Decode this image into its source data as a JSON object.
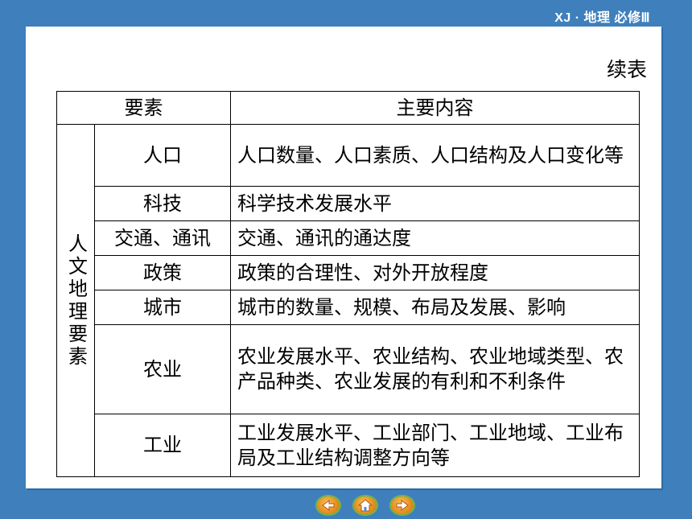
{
  "header": {
    "text": "XJ · 地理  必修Ⅲ"
  },
  "slide": {
    "subtitle": "续表",
    "table": {
      "col_factor": "要素",
      "col_content": "主要内容",
      "group_label": "人文地理要素",
      "rows": [
        {
          "factor": "人口",
          "content": "人口数量、人口素质、人口结构及人口变化等"
        },
        {
          "factor": "科技",
          "content": "科学技术发展水平"
        },
        {
          "factor": "交通、通讯",
          "content": "交通、通讯的通达度"
        },
        {
          "factor": "政策",
          "content": "政策的合理性、对外开放程度"
        },
        {
          "factor": "城市",
          "content": "城市的数量、规模、布局及发展、影响"
        },
        {
          "factor": "农业",
          "content": "农业发展水平、农业结构、农业地域类型、农产品种类、农业发展的有利和不利条件"
        },
        {
          "factor": "工业",
          "content": "工业发展水平、工业部门、工业地域、工业布局及工业结构调整方向等"
        }
      ]
    }
  },
  "nav": {
    "buttons": [
      {
        "icon": "back-icon"
      },
      {
        "icon": "home-icon"
      },
      {
        "icon": "forward-icon"
      }
    ]
  }
}
